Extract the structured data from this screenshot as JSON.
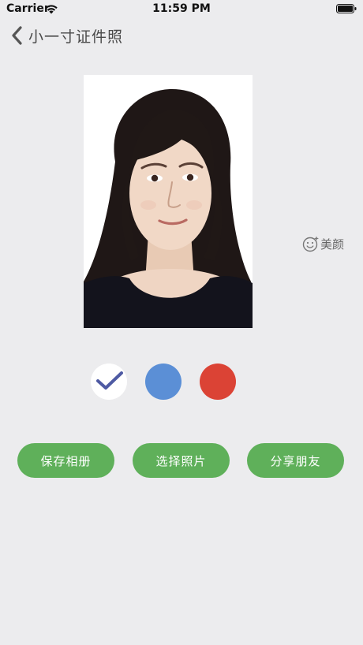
{
  "status_bar": {
    "carrier": "Carrier",
    "time": "11:59 PM",
    "wifi_icon": "wifi-icon",
    "battery_icon": "battery-icon"
  },
  "nav": {
    "back_icon": "chevron-left-icon",
    "title": "小一寸证件照"
  },
  "photo": {
    "subject": "id-photo-portrait"
  },
  "beauty": {
    "icon": "smiley-sparkle-icon",
    "label": "美颜"
  },
  "background_colors": {
    "selected_index": 0,
    "options": [
      {
        "name": "white",
        "color": "#ffffff",
        "check_color": "#4e5aa3"
      },
      {
        "name": "blue",
        "color": "#5b8fd6"
      },
      {
        "name": "red",
        "color": "#db4335"
      }
    ]
  },
  "actions": {
    "save_label": "保存相册",
    "choose_label": "选择照片",
    "share_label": "分享朋友",
    "button_color": "#5fb05a"
  }
}
